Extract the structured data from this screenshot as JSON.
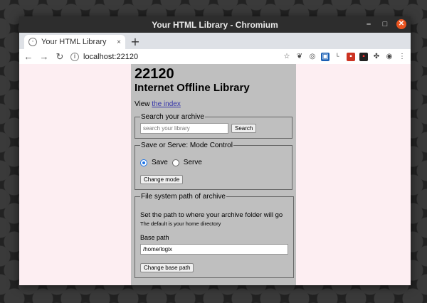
{
  "window": {
    "title": "Your HTML Library - Chromium"
  },
  "tab": {
    "title": "Your HTML Library",
    "close": "×",
    "new_tab": "+"
  },
  "toolbar": {
    "url": "localhost:22120"
  },
  "page": {
    "heading": "22120",
    "subheading": "Internet Offline Library",
    "view_prefix": "View ",
    "index_link": "the index",
    "search": {
      "legend": "Search your archive",
      "placeholder": "search your library",
      "button": "Search"
    },
    "mode": {
      "legend": "Save or Serve: Mode Control",
      "save_label": "Save",
      "serve_label": "Serve",
      "selected": "Save",
      "button": "Change mode"
    },
    "path": {
      "legend": "File system path of archive",
      "description": "Set the path to where your archive folder will go",
      "default_note": "The default is your home directory",
      "label": "Base path",
      "value": "/home/logix",
      "button": "Change base path"
    }
  },
  "colors": {
    "page_bg": "#fdeef2",
    "content_bg": "#bfbfbf",
    "link": "#3333aa",
    "titlebar": "#2d2d2d"
  }
}
